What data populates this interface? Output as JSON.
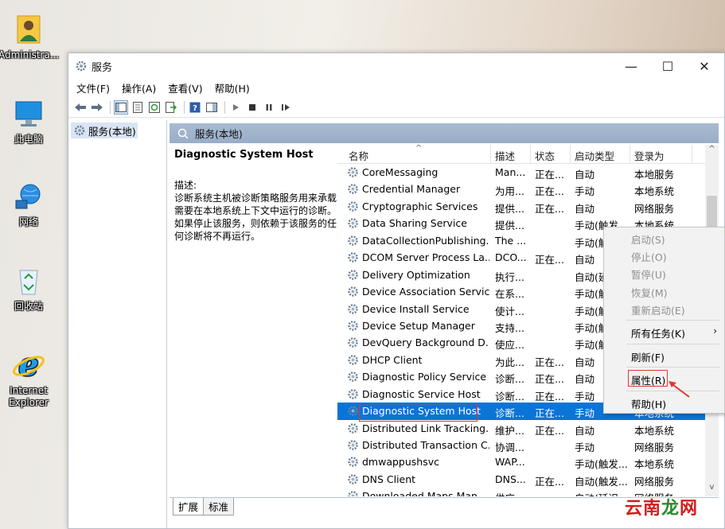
{
  "desktop": {
    "icons": [
      {
        "label": "Administra...",
        "icon": "user-folder-icon"
      },
      {
        "label": "此电脑",
        "icon": "computer-icon"
      },
      {
        "label": "网络",
        "icon": "network-icon"
      },
      {
        "label": "回收站",
        "icon": "recycle-bin-icon"
      },
      {
        "label": "Internet Explorer",
        "icon": "internet-explorer-icon"
      }
    ]
  },
  "window": {
    "title": "服务",
    "controls": {
      "minimize": "—",
      "maximize": "☐",
      "close": "✕"
    }
  },
  "menubar": [
    "文件(F)",
    "操作(A)",
    "查看(V)",
    "帮助(H)"
  ],
  "tree": {
    "item": "服务(本地)"
  },
  "pane": {
    "header": "服务(本地)"
  },
  "description": {
    "title": "Diagnostic System Host",
    "label": "描述:",
    "text": "诊断系统主机被诊断策略服务用来承载需要在本地系统上下文中运行的诊断。如果停止该服务，则依赖于该服务的任何诊断将不再运行。"
  },
  "columns": {
    "name": "名称",
    "desc": "描述",
    "status": "状态",
    "start": "启动类型",
    "logon": "登录为"
  },
  "services": [
    {
      "name": "CoreMessaging",
      "desc": "Man...",
      "status": "正在...",
      "start": "自动",
      "logon": "本地服务"
    },
    {
      "name": "Credential Manager",
      "desc": "为用...",
      "status": "正在...",
      "start": "手动",
      "logon": "本地系统"
    },
    {
      "name": "Cryptographic Services",
      "desc": "提供...",
      "status": "正在...",
      "start": "自动",
      "logon": "网络服务"
    },
    {
      "name": "Data Sharing Service",
      "desc": "提供...",
      "status": "",
      "start": "手动(触发",
      "logon": "本地系统"
    },
    {
      "name": "DataCollectionPublishing...",
      "desc": "The ...",
      "status": "",
      "start": "手动(触",
      "logon": ""
    },
    {
      "name": "DCOM Server Process La...",
      "desc": "DCO...",
      "status": "正在...",
      "start": "自动",
      "logon": ""
    },
    {
      "name": "Delivery Optimization",
      "desc": "执行...",
      "status": "",
      "start": "自动(延",
      "logon": ""
    },
    {
      "name": "Device Association Service",
      "desc": "在系...",
      "status": "",
      "start": "手动(触",
      "logon": ""
    },
    {
      "name": "Device Install Service",
      "desc": "使计...",
      "status": "",
      "start": "手动(触",
      "logon": ""
    },
    {
      "name": "Device Setup Manager",
      "desc": "支持...",
      "status": "",
      "start": "手动(触",
      "logon": ""
    },
    {
      "name": "DevQuery Background D...",
      "desc": "使应...",
      "status": "",
      "start": "手动(触",
      "logon": ""
    },
    {
      "name": "DHCP Client",
      "desc": "为此...",
      "status": "正在...",
      "start": "自动",
      "logon": ""
    },
    {
      "name": "Diagnostic Policy Service",
      "desc": "诊断...",
      "status": "正在...",
      "start": "自动",
      "logon": ""
    },
    {
      "name": "Diagnostic Service Host",
      "desc": "诊断...",
      "status": "正在...",
      "start": "手动",
      "logon": ""
    },
    {
      "name": "Diagnostic System Host",
      "desc": "诊断...",
      "status": "正在...",
      "start": "手动",
      "logon": "本地系统"
    },
    {
      "name": "Distributed Link Tracking...",
      "desc": "维护...",
      "status": "正在...",
      "start": "自动",
      "logon": "本地系统"
    },
    {
      "name": "Distributed Transaction C...",
      "desc": "协调...",
      "status": "",
      "start": "手动",
      "logon": "网络服务"
    },
    {
      "name": "dmwappushsvc",
      "desc": "WAP...",
      "status": "",
      "start": "手动(触发...",
      "logon": "本地系统"
    },
    {
      "name": "DNS Client",
      "desc": "DNS...",
      "status": "正在...",
      "start": "自动(触发...",
      "logon": "网络服务"
    },
    {
      "name": "Downloaded Maps Man...",
      "desc": "供应...",
      "status": "",
      "start": "自动(延迟",
      "logon": "网络服务"
    }
  ],
  "selected_index": 14,
  "context_menu": {
    "items": [
      {
        "label": "启动(S)",
        "enabled": false
      },
      {
        "label": "停止(O)",
        "enabled": false
      },
      {
        "label": "暂停(U)",
        "enabled": false
      },
      {
        "label": "恢复(M)",
        "enabled": false
      },
      {
        "label": "重新启动(E)",
        "enabled": false
      },
      {
        "label": "所有任务(K)",
        "enabled": true,
        "submenu": "›"
      },
      {
        "label": "刷新(F)",
        "enabled": true
      },
      {
        "label": "属性(R)",
        "enabled": true
      },
      {
        "label": "帮助(H)",
        "enabled": true
      }
    ]
  },
  "tabs": [
    "扩展",
    "标准"
  ],
  "watermark": {
    "a": "云南",
    "b": "龙",
    "c": "网"
  },
  "colors": {
    "selection": "#0a74d7",
    "annotation": "#e0382f",
    "pane_header": "#a9bbd1"
  }
}
